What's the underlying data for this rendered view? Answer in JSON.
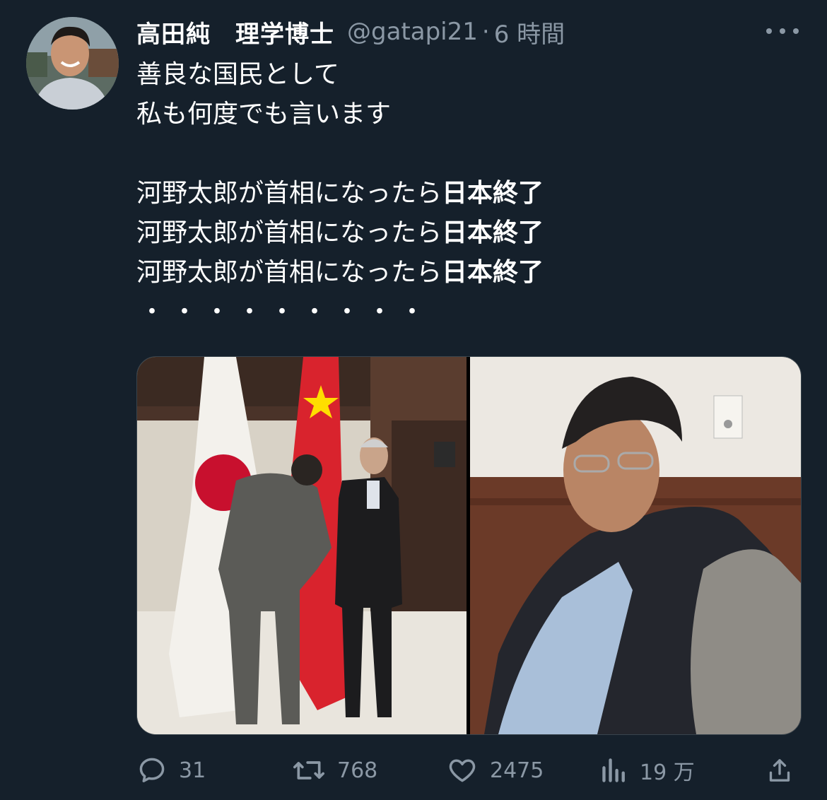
{
  "tweet": {
    "display_name": "高田純　理学博士",
    "handle": "@gatapi21",
    "separator": "·",
    "time": "6 時間",
    "lines": {
      "l1": "善良な国民として",
      "l2": "私も何度でも言います",
      "l3_prefix": "河野太郎が首相になったら",
      "l3_bold": "日本終了",
      "l4_prefix": "河野太郎が首相になったら",
      "l4_bold": "日本終了",
      "l5_prefix": "河野太郎が首相になったら",
      "l5_bold": "日本終了",
      "dots": "・・・・・・・・・"
    }
  },
  "actions": {
    "reply_count": "31",
    "retweet_count": "768",
    "like_count": "2475",
    "views_count": "19 万"
  },
  "icons": {
    "more": "more-horizontal-icon",
    "reply": "reply-icon",
    "retweet": "retweet-icon",
    "like": "heart-icon",
    "views": "views-icon",
    "share": "share-icon"
  },
  "colors": {
    "background": "#15202b",
    "primary_text": "#ffffff",
    "secondary_text": "#8b98a5"
  }
}
